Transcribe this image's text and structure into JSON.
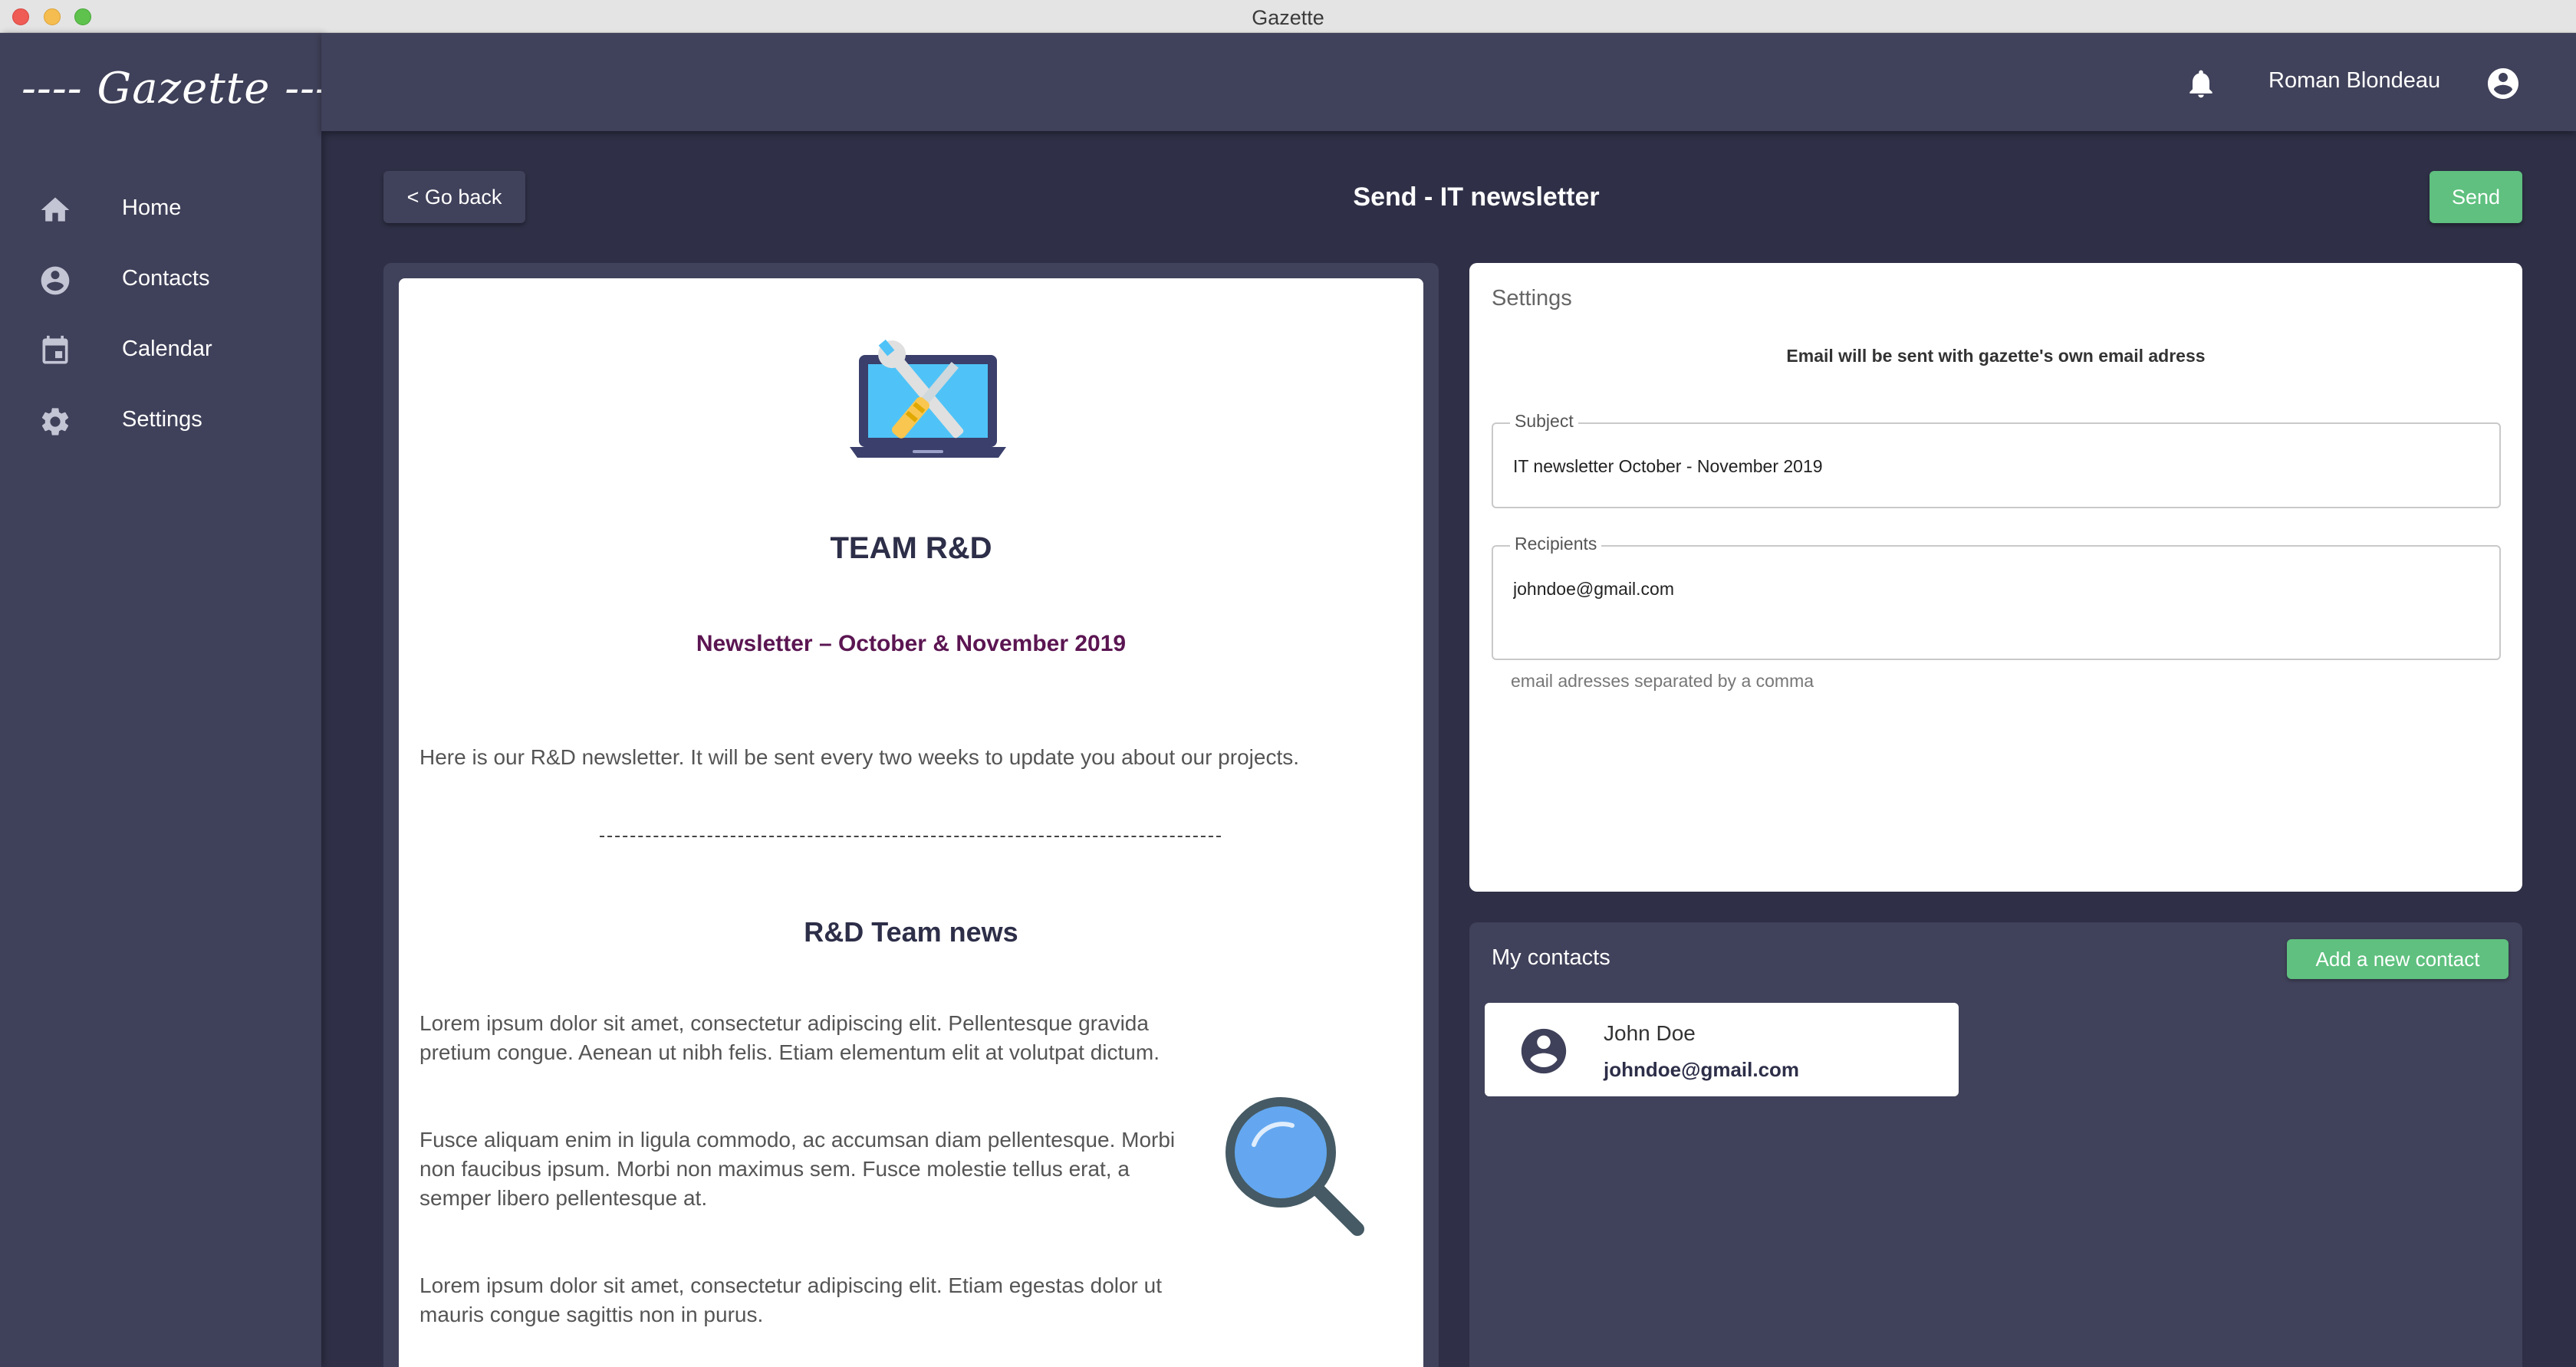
{
  "window": {
    "title": "Gazette"
  },
  "sidebar": {
    "brand": "---- Gazette ----",
    "items": [
      {
        "label": "Home",
        "icon": "home-icon"
      },
      {
        "label": "Contacts",
        "icon": "account-circle-icon"
      },
      {
        "label": "Calendar",
        "icon": "calendar-icon"
      },
      {
        "label": "Settings",
        "icon": "gear-icon"
      }
    ]
  },
  "header": {
    "user_name": "Roman Blondeau",
    "bell_icon": "bell-icon",
    "account_icon": "account-circle-icon"
  },
  "page": {
    "back_label": "< Go back",
    "title": "Send - IT newsletter",
    "send_label": "Send"
  },
  "preview": {
    "team_title": "TEAM R&D",
    "subtitle": "Newsletter – October & November 2019",
    "intro": "Here is our R&D newsletter. It will be sent every two weeks to update you about our projects.",
    "separator": "---------------------------------------------------------------------------------------------------",
    "section_title": "R&D Team news",
    "paragraphs": [
      "Lorem ipsum dolor sit amet, consectetur adipiscing elit. Pellentesque gravida pretium congue. Aenean ut nibh felis. Etiam elementum elit at volutpat dictum.",
      "Fusce aliquam enim in ligula commodo, ac accumsan diam pellentesque. Morbi non faucibus ipsum. Morbi non maximus sem. Fusce molestie tellus erat, a semper libero pellentesque at.",
      "Lorem ipsum dolor sit amet, consectetur adipiscing elit. Etiam egestas dolor ut mauris congue sagittis non in purus."
    ]
  },
  "settings": {
    "title": "Settings",
    "note": "Email will be sent with gazette's own email adress",
    "subject_label": "Subject",
    "subject_value": "IT newsletter October - November 2019",
    "recipients_label": "Recipients",
    "recipients_value": "johndoe@gmail.com",
    "recipients_helper": "email adresses separated by a comma"
  },
  "contacts": {
    "title": "My contacts",
    "add_label": "Add a new contact",
    "items": [
      {
        "name": "John Doe",
        "email": "johndoe@gmail.com"
      }
    ]
  },
  "colors": {
    "sidebar_bg": "#3f4059",
    "page_bg": "#2f3047",
    "accent_green": "#5fc07f",
    "subtitle_purple": "#5b1552"
  }
}
